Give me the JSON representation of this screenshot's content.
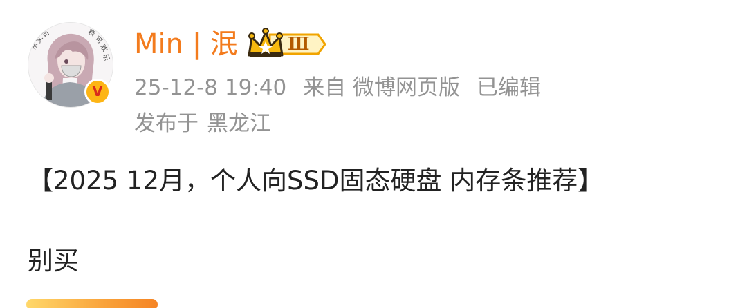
{
  "post": {
    "author": {
      "name": "Min | 泯",
      "vip_level": "Ⅲ",
      "verified_mark": "V",
      "avatar_icon": "anime-avatar-icon"
    },
    "meta": {
      "timestamp": "25-12-8 19:40",
      "source": "来自 微博网页版",
      "edited": "已编辑"
    },
    "location": {
      "prefix": "发布于",
      "place": "黑龙江"
    },
    "title": "【2025 12月，个人向SSD固态硬盘 内存条推荐】",
    "body": "别买"
  },
  "colors": {
    "username": "#f37b1d",
    "meta_text": "#939393",
    "body_text": "#222222",
    "verified_bg": "#fdb515",
    "crown": "#f7b90f"
  }
}
